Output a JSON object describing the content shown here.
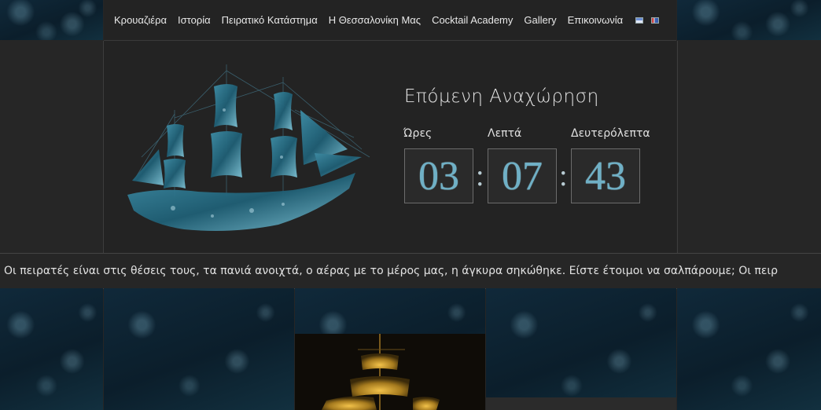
{
  "nav": {
    "items": [
      "Κρουαζιέρα",
      "Ιστορία",
      "Πειρατικό Κατάστημα",
      "Η Θεσσαλονίκη Μας",
      "Cocktail Academy",
      "Gallery",
      "Επικοινωνία"
    ],
    "flags": [
      "greek-flag-icon",
      "english-flag-icon"
    ]
  },
  "countdown": {
    "heading": "Επόμενη Αναχώρηση",
    "labels": {
      "hours": "Ώρες",
      "minutes": "Λεπτά",
      "seconds": "Δευτερόλεπτα"
    },
    "values": {
      "hours": "03",
      "minutes": "07",
      "seconds": "43"
    },
    "separator": ":"
  },
  "ticker": {
    "text": "Οι πειρατές είναι στις θέσεις τους, τα πανιά ανοιχτά, ο αέρας με το μέρος μας, η άγκυρα σηκώθηκε. Είστε έτοιμοι να σαλπάρουμε;   Οι πειρ"
  },
  "colors": {
    "background": "#262626",
    "digit": "#6fb0c6",
    "sea": "#0b1e2b"
  }
}
